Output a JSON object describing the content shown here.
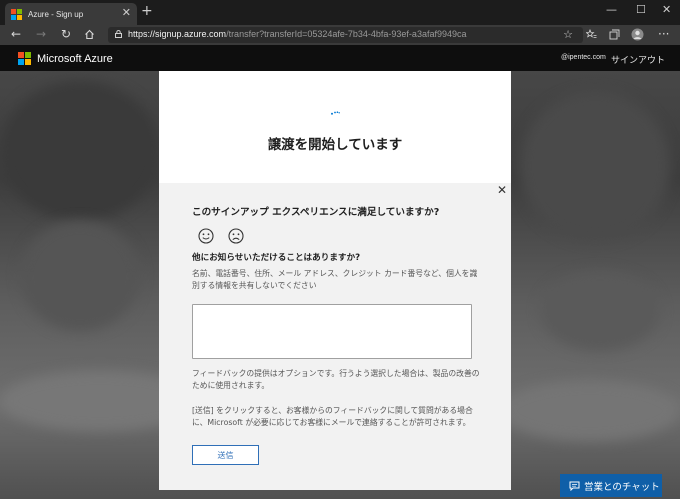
{
  "browser": {
    "tab_title": "Azure - Sign up",
    "tab_close": "✕",
    "new_tab": "+",
    "minimize": "—",
    "maximize": "☐",
    "close": "✕",
    "url_host": "https://signup.azure.com",
    "url_path": "/transfer?transferId=05324afe-7b34-4bfa-93ef-a3afaf9949ca"
  },
  "header": {
    "brand": "Microsoft Azure",
    "email": "@ipentec.com",
    "signin": "サインアウト"
  },
  "card": {
    "title": "譲渡を開始しています"
  },
  "feedback": {
    "close": "✕",
    "question": "このサインアップ エクスペリエンスに満足していますか?",
    "subquestion": "他にお知らせいただけることはありますか?",
    "hint": "名前、電話番号、住所、メール アドレス、クレジット カード番号など、個人を識別する情報を共有しないでください",
    "textarea_value": "",
    "note": "フィードバックの提供はオプションです。行うよう選択した場合は、製品の改善のために使用されます。",
    "terms": "[送信] をクリックすると、お客様からのフィードバックに関して質問がある場合に、Microsoft が必要に応じてお客様にメールで連絡することが許可されます。",
    "submit": "送信"
  },
  "chat": {
    "label": "営業とのチャット"
  },
  "colors": {
    "ms_red": "#f25022",
    "ms_green": "#7fba00",
    "ms_blue": "#00a4ef",
    "ms_yellow": "#ffb900",
    "link_blue": "#2f6fb7",
    "chat_blue": "#0f5fa8"
  },
  "icons": [
    "microsoft-logo-icon",
    "back-arrow-icon",
    "forward-arrow-icon",
    "refresh-icon",
    "home-icon",
    "lock-icon",
    "favorite-star-icon",
    "collections-icon",
    "profile-avatar-icon",
    "more-menu-icon",
    "spinner-icon",
    "happy-face-icon",
    "sad-face-icon",
    "chat-icon"
  ]
}
